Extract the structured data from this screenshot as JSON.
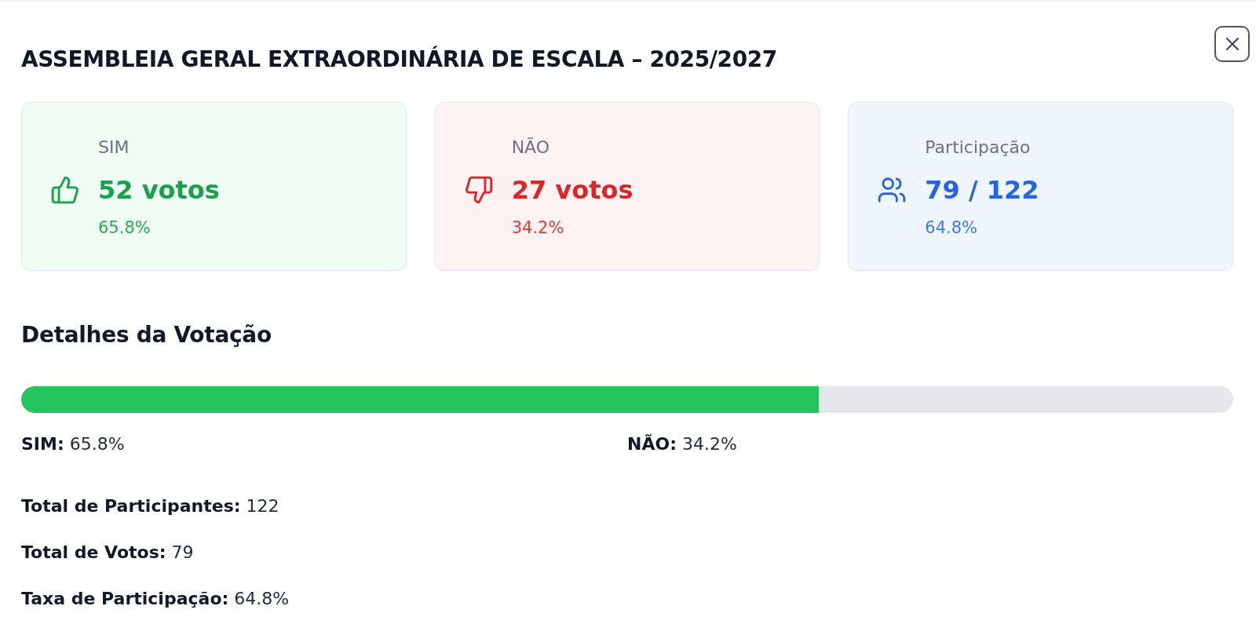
{
  "dialog": {
    "title": "ASSEMBLEIA GERAL EXTRAORDINÁRIA DE ESCALA – 2025/2027"
  },
  "cards": [
    {
      "kind": "yes",
      "label": "SIM",
      "value": "52 votos",
      "percent": "65.8%"
    },
    {
      "kind": "no",
      "label": "NÃO",
      "value": "27 votos",
      "percent": "34.2%"
    },
    {
      "kind": "participation",
      "label": "Participação",
      "value": "79 / 122",
      "percent": "64.8%"
    }
  ],
  "details": {
    "title": "Detalhes da Votação",
    "progress": {
      "level": 0.658
    },
    "legend": [
      "**SIM:** 65.8%",
      "**NÃO:** 34.2%"
    ],
    "stats": [
      "**Total de Participantes:** 122",
      "**Total de Votos:** 79",
      "**Taxa de Participação:** 64.8%"
    ]
  }
}
